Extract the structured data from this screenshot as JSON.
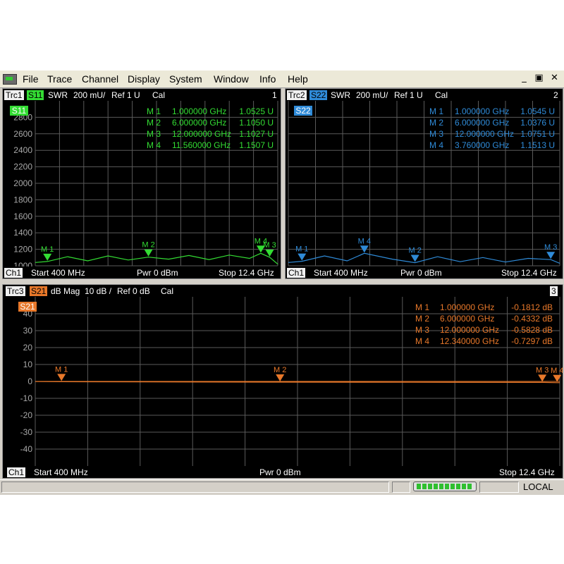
{
  "menubar": {
    "items": [
      "File",
      "Trace",
      "Channel",
      "Display",
      "System",
      "Window",
      "Info",
      "Help"
    ],
    "window_buttons": [
      "_",
      "▣",
      "✕"
    ]
  },
  "colors": {
    "trace1": "#33dd33",
    "trace2": "#2f8bd8",
    "trace3": "#e8782a",
    "grid": "#5a5a5a",
    "background": "#000000"
  },
  "panels": [
    {
      "trace_label": "Trc1",
      "param": "S11",
      "format": "SWR",
      "scale": "200 mU/",
      "ref": "Ref 1 U",
      "cal": "Cal",
      "index": "1",
      "overlay_label": "S11",
      "markers": [
        {
          "name": "M 1",
          "freq": "1.000000 GHz",
          "value": "1.0525 U"
        },
        {
          "name": "M 2",
          "freq": "6.000000 GHz",
          "value": "1.1050 U"
        },
        {
          "name": "M 3",
          "freq": "12.000000 GHz",
          "value": "1.1027 U"
        },
        {
          "name": "M 4",
          "freq": "11.560000 GHz",
          "value": "1.1507 U"
        }
      ],
      "channel": "Ch1",
      "start": "Start  400 MHz",
      "power": "Pwr  0 dBm",
      "stop": "Stop  12.4 GHz"
    },
    {
      "trace_label": "Trc2",
      "param": "S22",
      "format": "SWR",
      "scale": "200 mU/",
      "ref": "Ref 1 U",
      "cal": "Cal",
      "index": "2",
      "overlay_label": "S22",
      "markers": [
        {
          "name": "M 1",
          "freq": "1.000000 GHz",
          "value": "1.0545 U"
        },
        {
          "name": "M 2",
          "freq": "6.000000 GHz",
          "value": "1.0376 U"
        },
        {
          "name": "M 3",
          "freq": "12.000000 GHz",
          "value": "1.0751 U"
        },
        {
          "name": "M 4",
          "freq": "3.760000 GHz",
          "value": "1.1513 U"
        }
      ],
      "channel": "Ch1",
      "start": "Start  400 MHz",
      "power": "Pwr  0 dBm",
      "stop": "Stop  12.4 GHz"
    },
    {
      "trace_label": "Trc3",
      "param": "S21",
      "format": "dB Mag",
      "scale": "10 dB /",
      "ref": "Ref 0 dB",
      "cal": "Cal",
      "index": "3",
      "overlay_label": "S21",
      "markers": [
        {
          "name": "M 1",
          "freq": "1.000000 GHz",
          "value": "-0.1812  dB"
        },
        {
          "name": "M 2",
          "freq": "6.000000 GHz",
          "value": "-0.4332  dB"
        },
        {
          "name": "M 3",
          "freq": "12.000000 GHz",
          "value": "-0.5828  dB"
        },
        {
          "name": "M 4",
          "freq": "12.340000 GHz",
          "value": "-0.7297  dB"
        }
      ],
      "channel": "Ch1",
      "start": "Start  400 MHz",
      "power": "Pwr  0 dBm",
      "stop": "Stop  12.4 GHz"
    }
  ],
  "chart_data": [
    {
      "type": "line",
      "title": "Trc1 S11 SWR",
      "x_range_ghz": [
        0.4,
        12.4
      ],
      "ylim": [
        1000,
        3000
      ],
      "yticks": [
        2800,
        2600,
        2400,
        2200,
        2000,
        1800,
        1600,
        1400,
        1200,
        1000
      ],
      "series": [
        {
          "name": "S11",
          "x": [
            0.4,
            1.0,
            2.0,
            3.0,
            4.0,
            5.0,
            6.0,
            7.0,
            8.0,
            9.0,
            10.0,
            11.0,
            11.56,
            12.0,
            12.4
          ],
          "y": [
            1040,
            1052,
            1110,
            1060,
            1120,
            1070,
            1105,
            1080,
            1125,
            1075,
            1130,
            1090,
            1151,
            1103,
            1020
          ]
        }
      ],
      "markers": [
        {
          "name": "M 1",
          "x": 1.0,
          "y": 1052
        },
        {
          "name": "M 2",
          "x": 6.0,
          "y": 1105
        },
        {
          "name": "M 3",
          "x": 12.0,
          "y": 1103
        },
        {
          "name": "M 4",
          "x": 11.56,
          "y": 1151
        }
      ]
    },
    {
      "type": "line",
      "title": "Trc2 S22 SWR",
      "x_range_ghz": [
        0.4,
        12.4
      ],
      "ylim": [
        1000,
        3000
      ],
      "yticks": [
        2800,
        2600,
        2400,
        2200,
        2000,
        1800,
        1600,
        1400,
        1200,
        1000
      ],
      "series": [
        {
          "name": "S22",
          "x": [
            0.4,
            1.0,
            2.0,
            3.0,
            3.76,
            5.0,
            6.0,
            7.0,
            8.0,
            9.0,
            10.0,
            11.0,
            12.0,
            12.4
          ],
          "y": [
            1040,
            1055,
            1120,
            1060,
            1151,
            1080,
            1038,
            1110,
            1050,
            1100,
            1045,
            1090,
            1075,
            1030
          ]
        }
      ],
      "markers": [
        {
          "name": "M 1",
          "x": 1.0,
          "y": 1055
        },
        {
          "name": "M 2",
          "x": 6.0,
          "y": 1038
        },
        {
          "name": "M 3",
          "x": 12.0,
          "y": 1075
        },
        {
          "name": "M 4",
          "x": 3.76,
          "y": 1151
        }
      ]
    },
    {
      "type": "line",
      "title": "Trc3 S21 dB Mag",
      "x_range_ghz": [
        0.4,
        12.4
      ],
      "ylim": [
        -50,
        50
      ],
      "yticks": [
        40,
        30,
        20,
        10,
        0,
        -10,
        -20,
        -30,
        -40
      ],
      "series": [
        {
          "name": "S21",
          "x": [
            0.4,
            1.0,
            3.0,
            6.0,
            9.0,
            12.0,
            12.34,
            12.4
          ],
          "y": [
            -0.1,
            -0.18,
            -0.3,
            -0.43,
            -0.5,
            -0.58,
            -0.73,
            -0.75
          ]
        }
      ],
      "markers": [
        {
          "name": "M 1",
          "x": 1.0,
          "y": -0.18
        },
        {
          "name": "M 2",
          "x": 6.0,
          "y": -0.43
        },
        {
          "name": "M 3",
          "x": 12.0,
          "y": -0.58
        },
        {
          "name": "M 4",
          "x": 12.34,
          "y": -0.73
        }
      ]
    }
  ],
  "statusbar": {
    "mode": "LOCAL",
    "progress_segments": 10
  }
}
